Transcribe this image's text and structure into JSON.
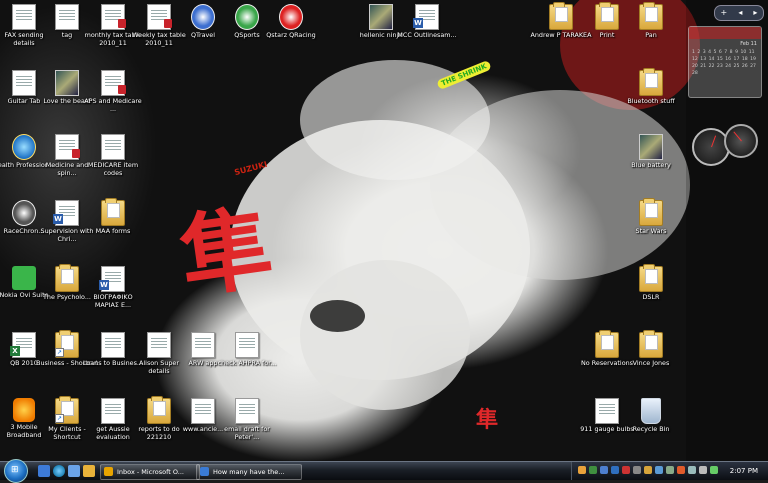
{
  "desktop": {
    "icons": [
      {
        "label": "FAX sending details",
        "type": "doc"
      },
      {
        "label": "tag",
        "type": "doc"
      },
      {
        "label": "monthly tax table 2010_11",
        "type": "pdf"
      },
      {
        "label": "Weekly tax table 2010_11",
        "type": "pdf"
      },
      {
        "label": "QTravel",
        "type": "app"
      },
      {
        "label": "QSports",
        "type": "app"
      },
      {
        "label": "Qstarz QRacing",
        "type": "app"
      },
      {
        "label": "hellenic ninja",
        "type": "image"
      },
      {
        "label": "MCC Outlinesam...",
        "type": "word"
      },
      {
        "label": "Guitar Tab",
        "type": "doc"
      },
      {
        "label": "Love the beast",
        "type": "image"
      },
      {
        "label": "APS and Medicare ...",
        "type": "pdf"
      },
      {
        "label": "Health Profession...",
        "type": "ie"
      },
      {
        "label": "Medicine and spin...",
        "type": "pdf"
      },
      {
        "label": "MEDICARE item codes",
        "type": "doc"
      },
      {
        "label": "RaceChron...",
        "type": "app"
      },
      {
        "label": "Supervision with Chri...",
        "type": "word"
      },
      {
        "label": "MAA forms",
        "type": "folder"
      },
      {
        "label": "Nokia Ovi Suite",
        "type": "ovi"
      },
      {
        "label": "The Psycholo...",
        "type": "folder"
      },
      {
        "label": "ΒΙΟΓΡΑΦΙΚΟ ΜΑΡΙΑΣ Ε...",
        "type": "word"
      },
      {
        "label": "QB 2010",
        "type": "excel"
      },
      {
        "label": "Business - Shortcut",
        "type": "folder"
      },
      {
        "label": "Loans to Busines...",
        "type": "doc"
      },
      {
        "label": "Alison Super details",
        "type": "doc"
      },
      {
        "label": "ARW app",
        "type": "doc"
      },
      {
        "label": "check AHPRA for...",
        "type": "doc"
      },
      {
        "label": "3 Mobile Broadband",
        "type": "three"
      },
      {
        "label": "My Clients - Shortcut",
        "type": "folder"
      },
      {
        "label": "get Aussie evaluation",
        "type": "doc"
      },
      {
        "label": "reports to do 221210",
        "type": "folder"
      },
      {
        "label": "www.ancie...",
        "type": "doc"
      },
      {
        "label": "email draft for Peter'...",
        "type": "doc"
      },
      {
        "label": "Andrew P TARAKEA",
        "type": "folder"
      },
      {
        "label": "Print",
        "type": "folder"
      },
      {
        "label": "Pan",
        "type": "folder"
      },
      {
        "label": "Bluetooth stuff",
        "type": "folder"
      },
      {
        "label": "Blue battery",
        "type": "image"
      },
      {
        "label": "Star Wars",
        "type": "folder"
      },
      {
        "label": "DSLR",
        "type": "folder"
      },
      {
        "label": "No Reservations",
        "type": "folder"
      },
      {
        "label": "Vince Jones",
        "type": "folder"
      },
      {
        "label": "911 gauge bulbs",
        "type": "doc"
      },
      {
        "label": "Recycle Bin",
        "type": "bin"
      }
    ]
  },
  "wallpaper": {
    "brand_text": "SUZUKI",
    "glyph": "隼",
    "sticker": "THE SHRINK"
  },
  "gadgets": {
    "controls": [
      "+",
      "◂",
      "▸"
    ],
    "calendar_month": "Feb 11",
    "calendar_days": "1 2 3 4 5 6 7 8 9 10 11 12 13 14 15 16 17 18 19 20 21 22 23 24 25 26 27 28"
  },
  "taskbar": {
    "start_glyph": "⊞",
    "buttons": [
      {
        "label": "Inbox - Microsoft O...",
        "color": "#e8a400"
      },
      {
        "label": "How many have the...",
        "color": "#3a7bd5"
      }
    ],
    "clock": "2:07 PM"
  },
  "colors": {
    "accent_red": "#e0282a",
    "taskbar_dark": "#0a0c10",
    "label_text": "#ffffff"
  }
}
